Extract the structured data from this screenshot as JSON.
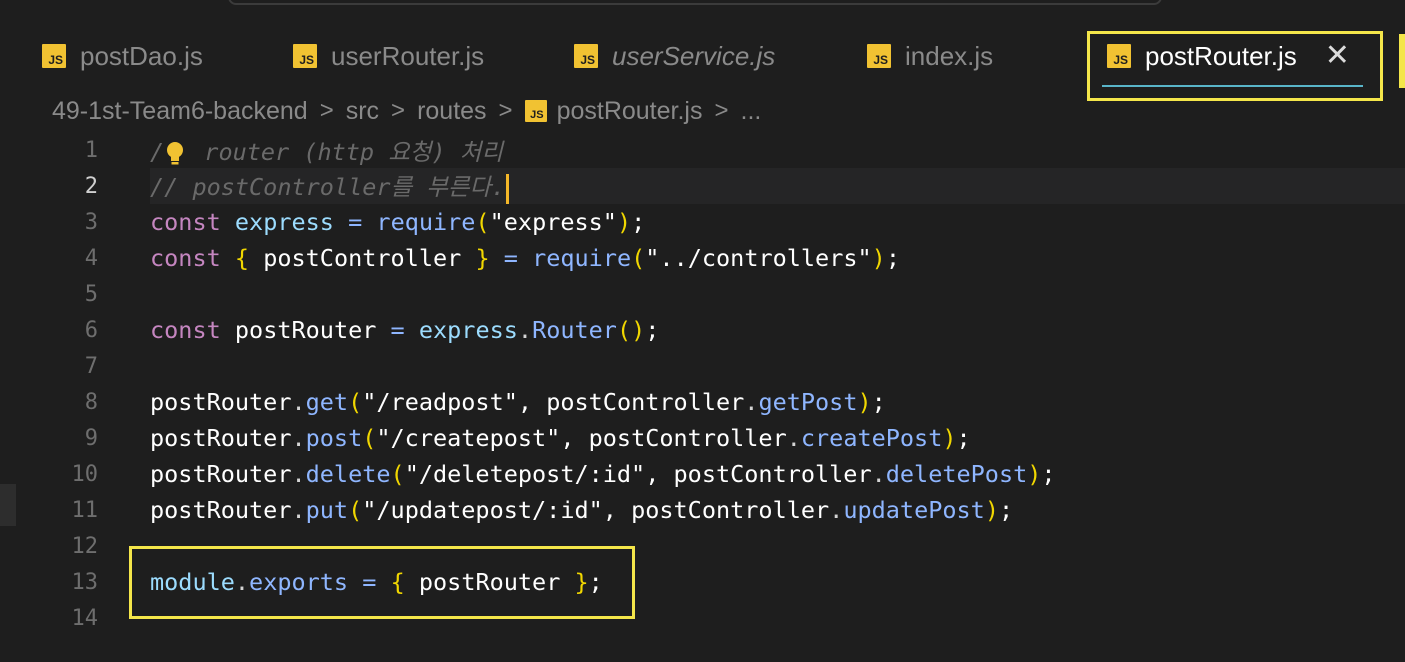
{
  "tabs": [
    {
      "label": "postDao.js",
      "icon": "js-file-icon",
      "italic": false
    },
    {
      "label": "userRouter.js",
      "icon": "js-file-icon",
      "italic": false
    },
    {
      "label": "userService.js",
      "icon": "js-file-icon",
      "italic": true
    },
    {
      "label": "index.js",
      "icon": "js-file-icon",
      "italic": false
    },
    {
      "label": "postRouter.js",
      "icon": "js-file-icon",
      "italic": false,
      "active": true,
      "close": "✕"
    }
  ],
  "js_icon_text": "JS",
  "breadcrumb": {
    "items": [
      "49-1st-Team6-backend",
      "src",
      "routes",
      "postRouter.js",
      "..."
    ],
    "separator": ">"
  },
  "editor": {
    "current_line": 2,
    "lines": [
      {
        "no": "1",
        "text": "// router (http 요청) 처리"
      },
      {
        "no": "2",
        "text": "// postController를 부른다."
      },
      {
        "no": "3",
        "text": "const express = require(\"express\");"
      },
      {
        "no": "4",
        "text": "const { postController } = require(\"../controllers\");"
      },
      {
        "no": "5",
        "text": ""
      },
      {
        "no": "6",
        "text": "const postRouter = express.Router();"
      },
      {
        "no": "7",
        "text": ""
      },
      {
        "no": "8",
        "text": "postRouter.get(\"/readpost\", postController.getPost);"
      },
      {
        "no": "9",
        "text": "postRouter.post(\"/createpost\", postController.createPost);"
      },
      {
        "no": "10",
        "text": "postRouter.delete(\"/deletepost/:id\", postController.deletePost);"
      },
      {
        "no": "11",
        "text": "postRouter.put(\"/updatepost/:id\", postController.updatePost);"
      },
      {
        "no": "12",
        "text": ""
      },
      {
        "no": "13",
        "text": "module.exports = { postRouter };"
      },
      {
        "no": "14",
        "text": ""
      }
    ]
  },
  "colors": {
    "highlight": "#f4e64a",
    "js_icon": "#f1c232",
    "tab_underline": "#59b5c9"
  }
}
